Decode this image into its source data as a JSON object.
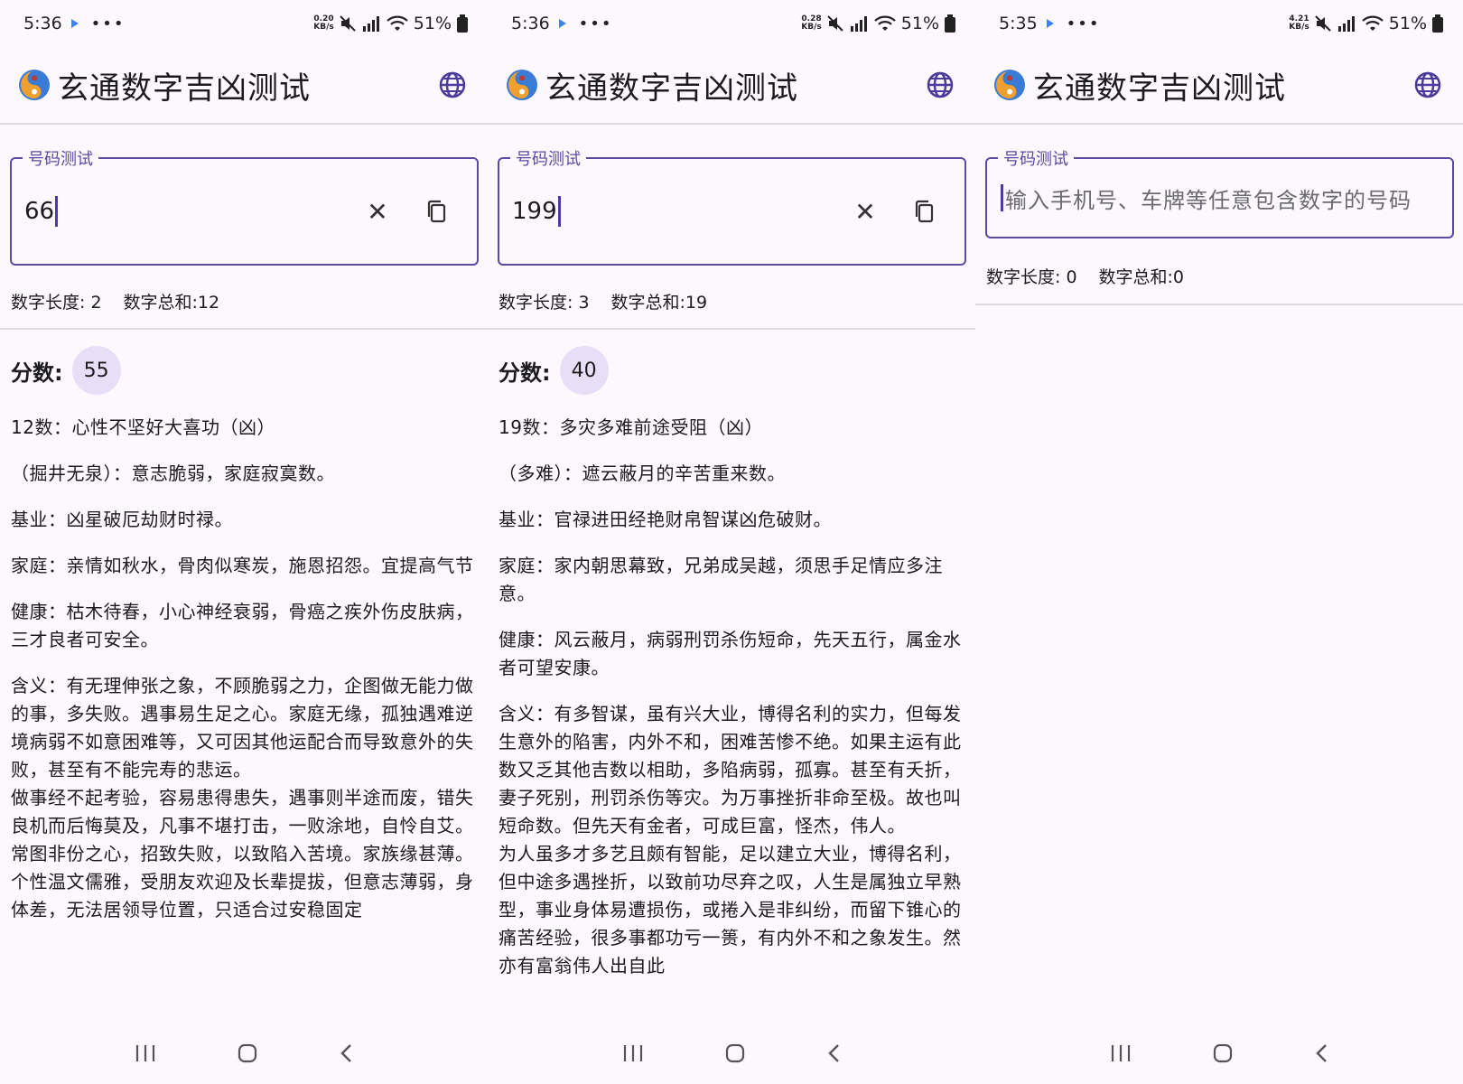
{
  "colors": {
    "accent": "#5b4aa0",
    "badge_bg": "#e8def8",
    "background": "#fdf8fd",
    "divider": "#dcdcdc"
  },
  "panels": [
    {
      "status": {
        "time": "5:36",
        "speed_top": "0.20",
        "speed_bottom": "KB/s",
        "battery": "51%"
      },
      "app_title": "玄通数字吉凶测试",
      "field_label": "号码测试",
      "input_value": "66",
      "stats": {
        "length": "数字长度: 2",
        "sum": "数字总和:12"
      },
      "score_label": "分数:",
      "score": "55",
      "paragraphs": [
        "12数：心性不坚好大喜功（凶）",
        "（掘井无泉）：意志脆弱，家庭寂寞数。",
        "基业：凶星破厄劫财时禄。",
        "家庭：亲情如秋水，骨肉似寒炭，施恩招怨。宜提高气节",
        "健康：枯木待春，小心神经衰弱，骨癌之疾外伤皮肤病，三才良者可安全。",
        "含义：有无理伸张之象，不顾脆弱之力，企图做无能力做的事，多失败。遇事易生足之心。家庭无缘，孤独遇难逆境病弱不如意困难等，又可因其他运配合而导致意外的失败，甚至有不能完寿的悲运。",
        "做事经不起考验，容易患得患失，遇事则半途而废，错失良机而后悔莫及，凡事不堪打击，一败涂地，自怜自艾。常图非份之心，招致失败，以致陷入苦境。家族缘甚薄。",
        "个性温文儒雅，受朋友欢迎及长辈提拔，但意志薄弱，身体差，无法居领导位置，只适合过安稳固定"
      ]
    },
    {
      "status": {
        "time": "5:36",
        "speed_top": "0.28",
        "speed_bottom": "KB/s",
        "battery": "51%"
      },
      "app_title": "玄通数字吉凶测试",
      "field_label": "号码测试",
      "input_value": "199",
      "stats": {
        "length": "数字长度: 3",
        "sum": "数字总和:19"
      },
      "score_label": "分数:",
      "score": "40",
      "paragraphs": [
        "19数：多灾多难前途受阻（凶）",
        "（多难）：遮云蔽月的辛苦重来数。",
        "基业：官禄进田经艳财帛智谋凶危破财。",
        "家庭：家内朝思幕致，兄弟成吴越，须思手足情应多注意。",
        "健康：风云蔽月，病弱刑罚杀伤短命，先天五行，属金水者可望安康。",
        "含义：有多智谋，虽有兴大业，博得名利的实力，但每发生意外的陷害，内外不和，困难苦惨不绝。如果主运有此数又乏其他吉数以相助，多陷病弱，孤寡。甚至有夭折，妻子死别，刑罚杀伤等灾。为万事挫折非命至极。故也叫短命数。但先天有金者，可成巨富，怪杰，伟人。",
        "为人虽多才多艺且颇有智能，足以建立大业，博得名利，但中途多遇挫折，以致前功尽弃之叹，人生是属独立早熟型，事业身体易遭损伤，或捲入是非纠纷，而留下锥心的痛苦经验，很多事都功亏一篑，有内外不和之象发生。然亦有富翁伟人出自此"
      ]
    },
    {
      "status": {
        "time": "5:35",
        "speed_top": "4.21",
        "speed_bottom": "KB/s",
        "battery": "51%"
      },
      "app_title": "玄通数字吉凶测试",
      "field_label": "号码测试",
      "placeholder": "输入手机号、车牌等任意包含数字的号码",
      "stats": {
        "length": "数字长度: 0",
        "sum": "数字总和:0"
      }
    }
  ]
}
